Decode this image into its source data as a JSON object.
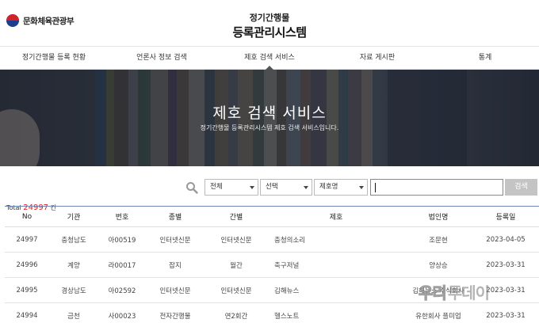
{
  "header": {
    "logo_text": "문화체육관광부",
    "title_line1": "정기간행물",
    "title_line2": "등록관리시스템"
  },
  "nav": {
    "items": [
      {
        "label": "정기간행물 등록 현황"
      },
      {
        "label": "언론사 정보 검색"
      },
      {
        "label": "제호 검색 서비스"
      },
      {
        "label": "자료 게시판"
      },
      {
        "label": "통계"
      }
    ],
    "active_index": 2
  },
  "banner": {
    "title": "제호 검색 서비스",
    "subtitle": "정기간행물 등록관리시스템 제호 검색 서비스입니다."
  },
  "search": {
    "select1": "전체",
    "select2": "선택",
    "select3": "제호명",
    "input_value": "",
    "button_label": "검색"
  },
  "total": {
    "label": "Total",
    "count": "24997",
    "unit": "건"
  },
  "table": {
    "headers": [
      "No",
      "기관",
      "번호",
      "종별",
      "간별",
      "제호",
      "법인명",
      "등록일"
    ],
    "rows": [
      [
        "24997",
        "충청남도",
        "아00519",
        "인터넷신문",
        "인터넷신문",
        "충청의소리",
        "조문현",
        "2023-04-05"
      ],
      [
        "24996",
        "계양",
        "라00017",
        "잡지",
        "월간",
        "축구저널",
        "양상승",
        "2023-03-31"
      ],
      [
        "24995",
        "경상남도",
        "아02592",
        "인터넷신문",
        "인터넷신문",
        "김해뉴스",
        "김해뉴스 주식회사",
        "2023-03-31"
      ],
      [
        "24994",
        "금천",
        "사00023",
        "전자간행물",
        "연2회간",
        "헬스노트",
        "유한회사 플미업",
        "2023-03-31"
      ]
    ]
  },
  "watermark": {
    "part1": "우리",
    "part2": "투데이"
  },
  "colors": {
    "accent_line": "#6d86b3",
    "total_count": "#e02020",
    "search_button": "#c4c4c4"
  }
}
